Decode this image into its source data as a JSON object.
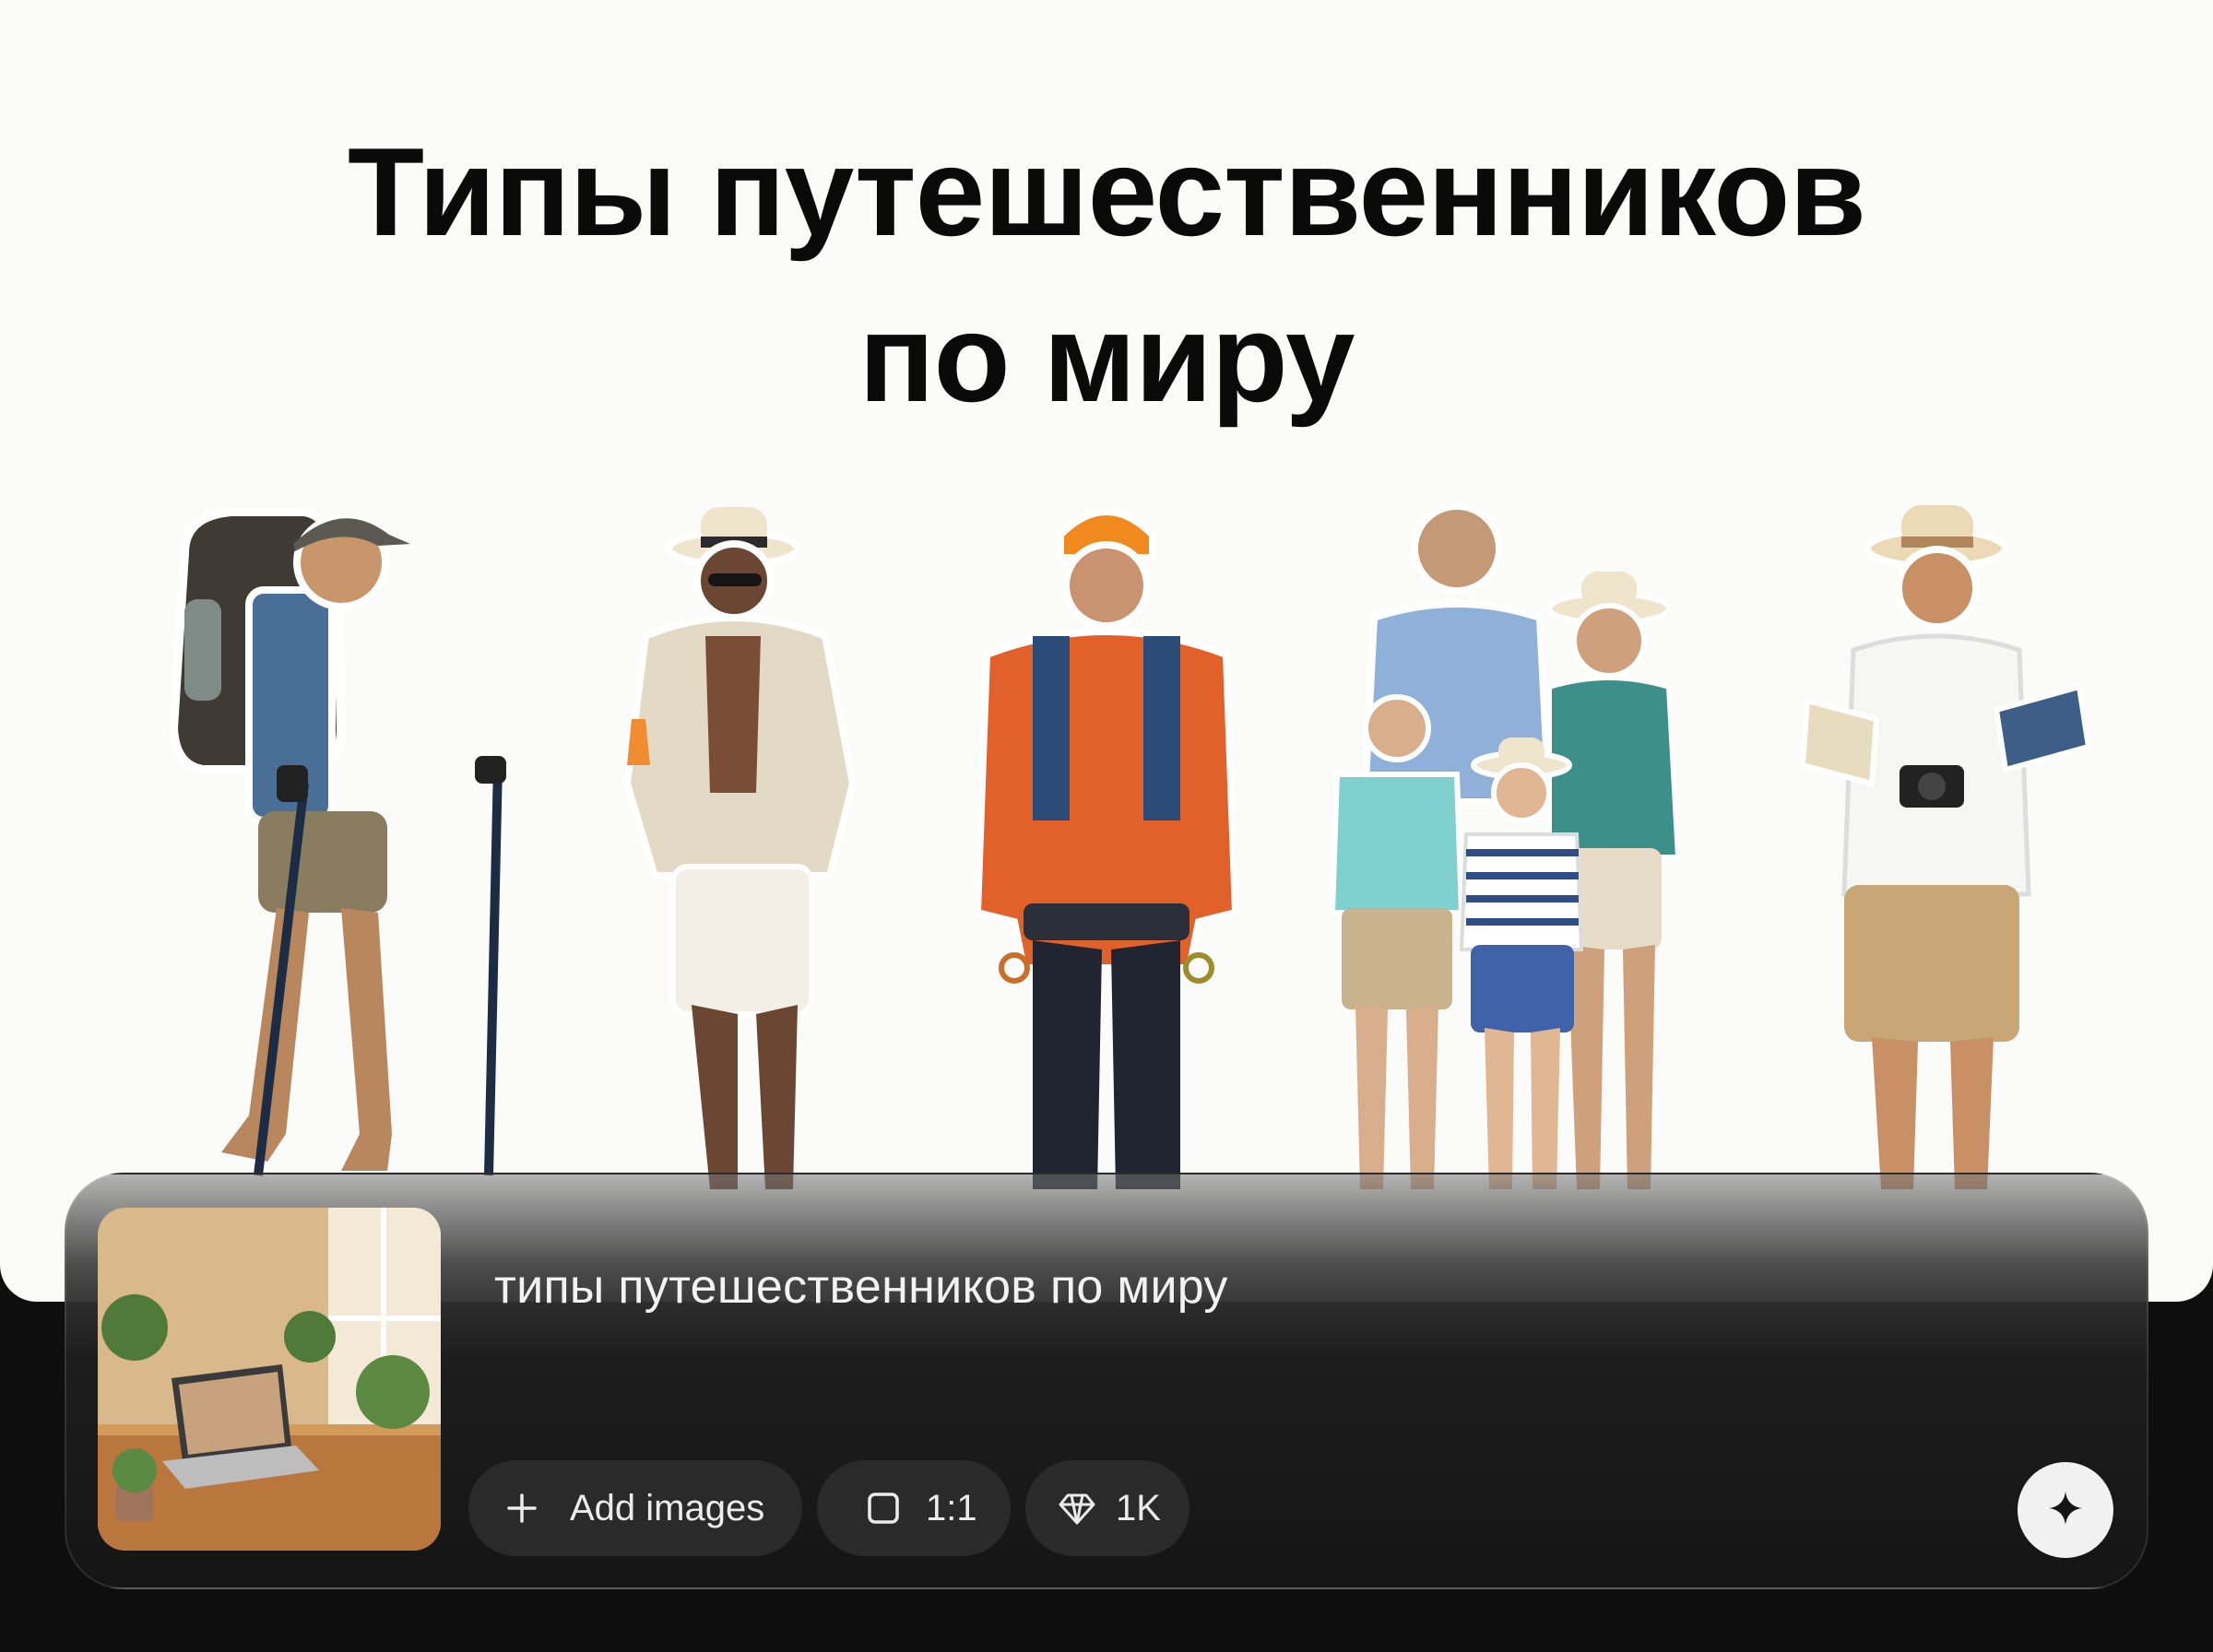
{
  "canvas": {
    "title_line1": "Типы путешественников",
    "title_line2": "по миру",
    "figures": [
      {
        "name": "hiker-with-backpack"
      },
      {
        "name": "beach-tourist"
      },
      {
        "name": "climber-with-helmet"
      },
      {
        "name": "family-travelers"
      },
      {
        "name": "cultural-tourist-with-camera"
      }
    ]
  },
  "prompt_bar": {
    "prompt_text": "типы путешественников по миру",
    "add_images_label": "Add images",
    "aspect_ratio_label": "1:1",
    "resolution_label": "1K",
    "icons": {
      "add": "plus-icon",
      "ratio": "square-icon",
      "resolution": "diamond-icon",
      "generate": "sparkle-icon"
    }
  },
  "colors": {
    "canvas_bg": "#fbfbfa",
    "page_bg": "#0e0e0e",
    "prompt_bar_bg": "#151515",
    "chip_bg": "#2a2a2a",
    "generate_button_bg": "#f1f1f1"
  }
}
